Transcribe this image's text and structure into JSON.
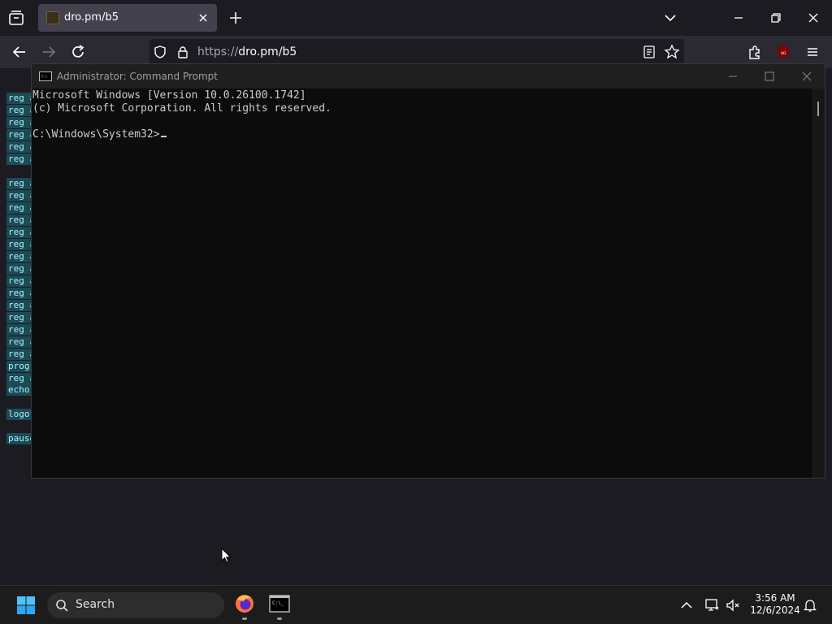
{
  "browser": {
    "tab": {
      "title": "dro.pm/b5"
    },
    "url": {
      "scheme": "https://",
      "rest": "dro.pm/b5"
    }
  },
  "page": {
    "code_lines": [
      "reg a",
      "reg a",
      "reg a",
      "reg a",
      "reg a",
      "reg a",
      "reg a",
      "reg a",
      "reg a",
      "reg a",
      "reg a",
      "reg a",
      "reg a",
      "reg a",
      "reg a",
      "reg a",
      "reg a",
      "reg a",
      "reg a",
      "reg a",
      "reg a",
      "progr",
      "reg a",
      "echo",
      "logof",
      "pause"
    ]
  },
  "cmd": {
    "title": "Administrator: Command Prompt",
    "lines": [
      "Microsoft Windows [Version 10.0.26100.1742]",
      "(c) Microsoft Corporation. All rights reserved.",
      "",
      "C:\\Windows\\System32>"
    ]
  },
  "taskbar": {
    "search_label": "Search",
    "time": "3:56 AM",
    "date": "12/6/2024"
  },
  "icons": {
    "tab_list": "tab-list-icon",
    "back": "back-arrow-icon",
    "forward": "forward-arrow-icon",
    "reload": "reload-icon",
    "shield": "tracking-shield-icon",
    "lock": "lock-icon",
    "reader": "reader-view-icon",
    "bookmark": "star-icon",
    "extensions": "extensions-icon",
    "ublock": "ublock-icon",
    "menu": "hamburger-menu-icon"
  },
  "colors": {
    "browser_bg": "#1c1b22",
    "toolbar_bg": "#2b2a33",
    "cmd_bg": "#0c0c0c",
    "code_highlight": "#1b4b55",
    "ublock_red": "#800000"
  }
}
